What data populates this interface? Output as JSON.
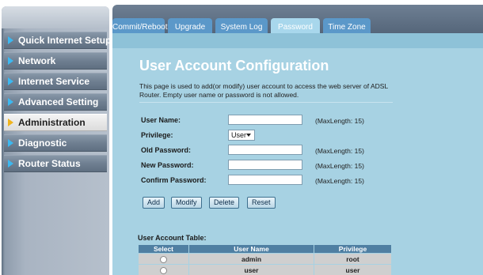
{
  "sidebar": {
    "items": [
      {
        "label": "Quick Internet Setup",
        "active": false
      },
      {
        "label": "Network",
        "active": false
      },
      {
        "label": "Internet Service",
        "active": false
      },
      {
        "label": "Advanced Setting",
        "active": false
      },
      {
        "label": "Administration",
        "active": true
      },
      {
        "label": "Diagnostic",
        "active": false
      },
      {
        "label": "Router Status",
        "active": false
      }
    ]
  },
  "tabs": [
    {
      "label": "Commit/Reboot",
      "active": false
    },
    {
      "label": "Upgrade",
      "active": false
    },
    {
      "label": "System Log",
      "active": false
    },
    {
      "label": "Password",
      "active": true
    },
    {
      "label": "Time Zone",
      "active": false
    }
  ],
  "page": {
    "title": "User Account Configuration",
    "description": "This page is used to add(or modify) user account to access the web server of ADSL Router. Empty user name or password is not allowed."
  },
  "form": {
    "user_name": {
      "label": "User Name:",
      "value": "",
      "note": "(MaxLength: 15)"
    },
    "privilege": {
      "label": "Privilege:",
      "value": "User"
    },
    "old_password": {
      "label": "Old Password:",
      "value": "",
      "note": "(MaxLength: 15)"
    },
    "new_password": {
      "label": "New Password:",
      "value": "",
      "note": "(MaxLength: 15)"
    },
    "confirm_password": {
      "label": "Confirm Password:",
      "value": "",
      "note": "(MaxLength: 15)"
    }
  },
  "buttons": {
    "add": "Add",
    "modify": "Modify",
    "delete": "Delete",
    "reset": "Reset"
  },
  "table": {
    "caption": "User Account Table:",
    "headers": [
      "Select",
      "User Name",
      "Privilege"
    ],
    "rows": [
      {
        "user_name": "admin",
        "privilege": "root"
      },
      {
        "user_name": "user",
        "privilege": "user"
      }
    ]
  },
  "colors": {
    "content_bg": "#a7d2e3",
    "tab_bg": "#5b98c9",
    "tab_active_bg": "#a8d7ec",
    "menu_arrow": "#3cb8f0",
    "menu_arrow_active": "#f0b41e",
    "table_header_bg": "#4f7fa2"
  },
  "icons": [
    "arrow-right-icon",
    "select-caret-icon",
    "radio-button"
  ]
}
